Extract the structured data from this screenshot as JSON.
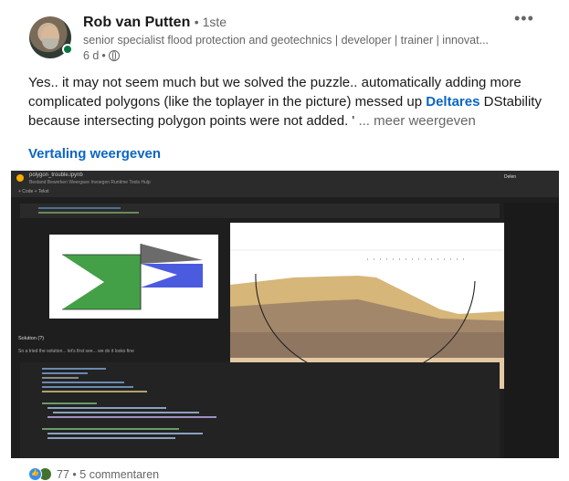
{
  "post": {
    "author_name": "Rob van Putten",
    "degree": "1ste",
    "headline": "senior specialist flood protection and geotechnics | developer | trainer | innovat...",
    "time_ago": "6 d",
    "menu_glyph": "•••",
    "text_before_mention": "Yes.. it may not seem much but we solved the puzzle.. automatically adding more complicated polygons (like the toplayer in the picture) messed up ",
    "mention": "Deltares",
    "text_after_mention": " DStability because intersecting polygon points were not added. '",
    "see_more_label": "... meer weergeven",
    "translate_label": "Vertaling weergeven"
  },
  "image": {
    "notebook_filename": "polygon_trouble.ipynb",
    "notebook_menu": "Bestand  Bewerken  Weergave  Invoegen  Runtime  Tools  Hulp",
    "toolbar_text": "+ Code  + Tekst",
    "share_label": "Delen",
    "solution_title": "Solution (?)",
    "solution_sub": "So a tried the solution... let's first see... we do it looks fine"
  },
  "footer": {
    "reaction_count": "77",
    "separator": "•",
    "comments": "5 commentaren"
  },
  "colors": {
    "link": "#0a66c2",
    "muted": "#666666",
    "online": "#057642"
  }
}
